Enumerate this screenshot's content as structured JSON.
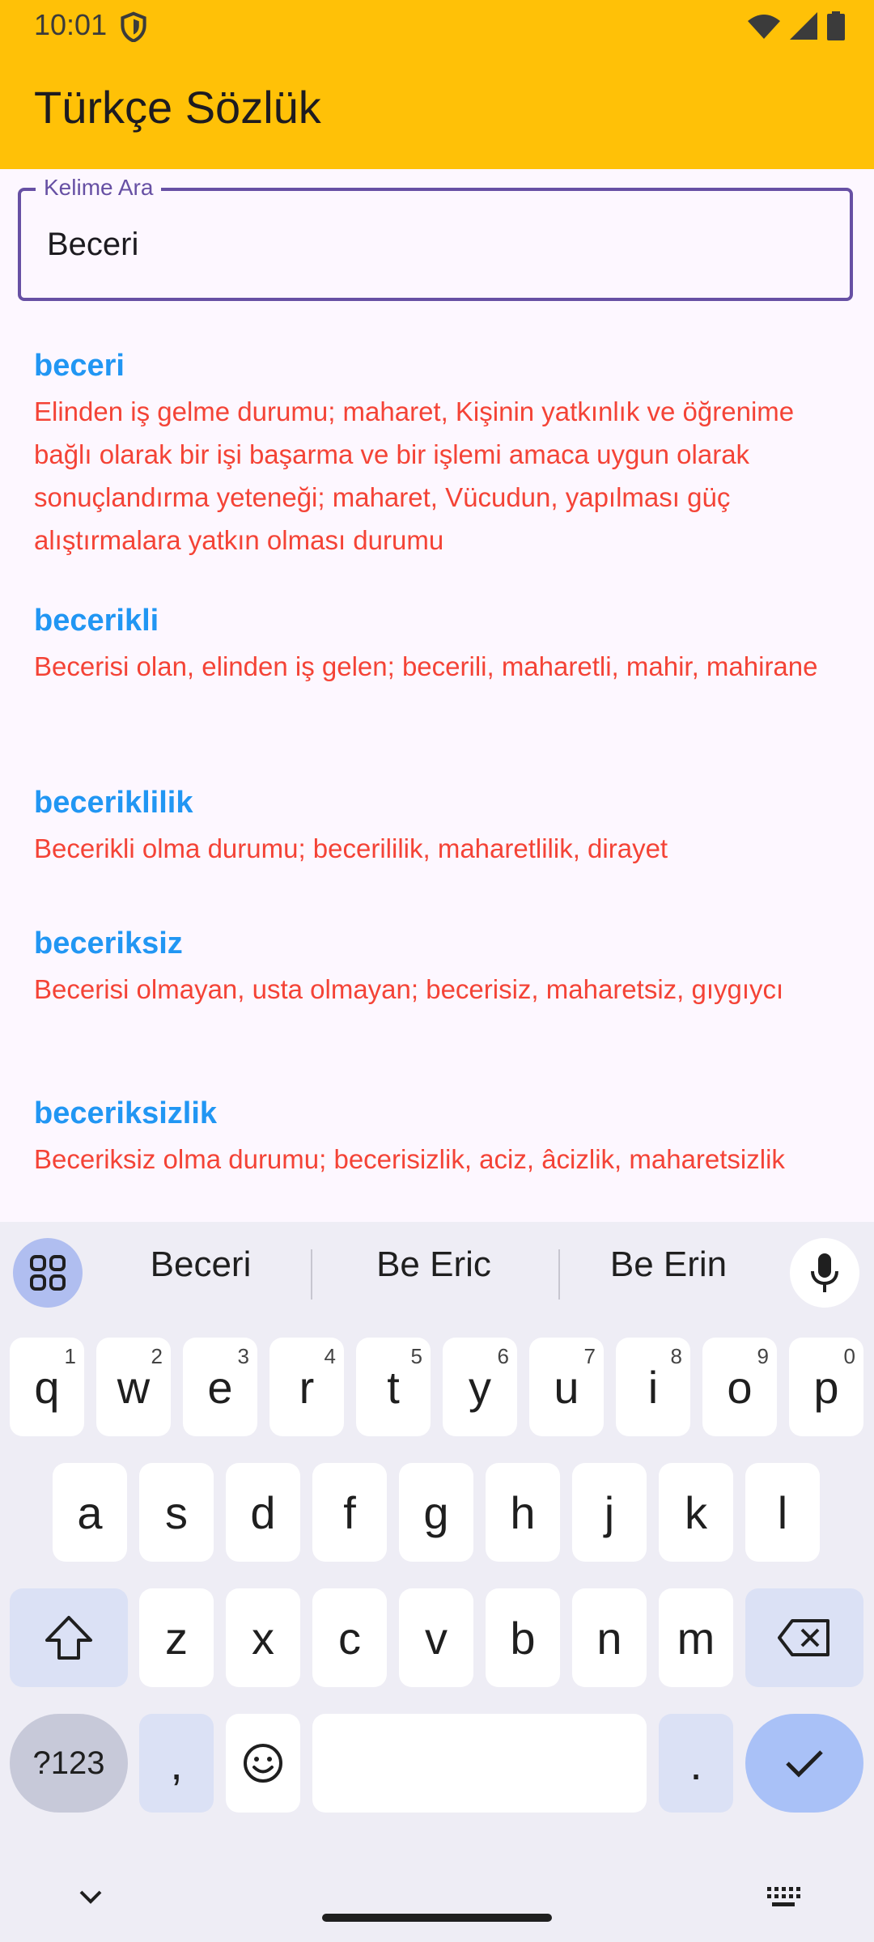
{
  "status": {
    "time": "10:01"
  },
  "app": {
    "title": "Türkçe Sözlük"
  },
  "search": {
    "label": "Kelime Ara",
    "value": "Beceri"
  },
  "entries": [
    {
      "word": "beceri",
      "definition": "Elinden iş gelme durumu; maharet, Kişinin yatkınlık ve öğrenime bağlı olarak bir işi başarma ve bir işlemi amaca uygun olarak sonuçlandırma yeteneği; maharet, Vücudun, yapılması güç alıştırmalara yatkın olması durumu"
    },
    {
      "word": "becerikli",
      "definition": "Becerisi olan, elinden iş gelen; becerili, maharetli, mahir, mahirane"
    },
    {
      "word": "beceriklilik",
      "definition": "Becerikli olma durumu; becerililik, maharetlilik, dirayet"
    },
    {
      "word": "beceriksiz",
      "definition": "Becerisi olmayan, usta olmayan; becerisiz, maharetsiz, gıygıycı"
    },
    {
      "word": "beceriksizlik",
      "definition": "Beceriksiz olma durumu; becerisizlik, aciz, âcizlik, maharetsizlik"
    }
  ],
  "keyboard": {
    "suggestions": [
      "Beceri",
      "Be Eric",
      "Be Erin"
    ],
    "row1": [
      {
        "key": "q",
        "hint": "1"
      },
      {
        "key": "w",
        "hint": "2"
      },
      {
        "key": "e",
        "hint": "3"
      },
      {
        "key": "r",
        "hint": "4"
      },
      {
        "key": "t",
        "hint": "5"
      },
      {
        "key": "y",
        "hint": "6"
      },
      {
        "key": "u",
        "hint": "7"
      },
      {
        "key": "i",
        "hint": "8"
      },
      {
        "key": "o",
        "hint": "9"
      },
      {
        "key": "p",
        "hint": "0"
      }
    ],
    "row2": [
      "a",
      "s",
      "d",
      "f",
      "g",
      "h",
      "j",
      "k",
      "l"
    ],
    "row3": [
      "z",
      "x",
      "c",
      "v",
      "b",
      "n",
      "m"
    ],
    "symbols_label": "?123",
    "comma_label": ",",
    "period_label": "."
  },
  "icons": {
    "shield": "shield-icon",
    "wifi": "wifi-icon",
    "signal": "signal-icon",
    "battery": "battery-icon",
    "apps": "apps-grid-icon",
    "mic": "microphone-icon",
    "shift": "shift-icon",
    "backspace": "backspace-icon",
    "emoji": "emoji-icon",
    "enter": "checkmark-icon",
    "hide": "chevron-down-icon",
    "keyboard": "keyboard-icon"
  },
  "colors": {
    "app_bar": "#ffc107",
    "word": "#2196f3",
    "definition": "#f44336",
    "field_border": "#6750a4",
    "background": "#fdf7ff"
  }
}
